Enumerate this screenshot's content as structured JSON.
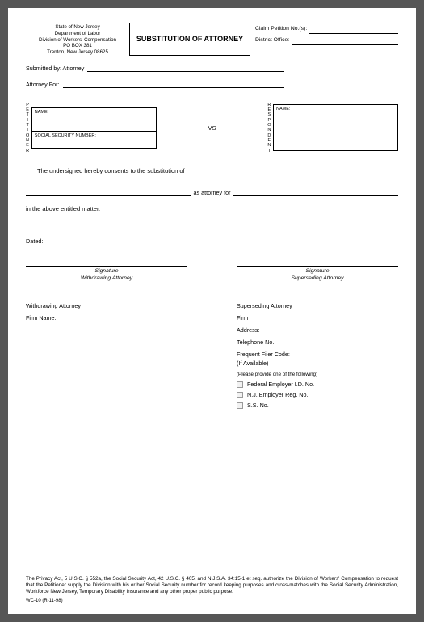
{
  "header": {
    "agency_line1": "State of New Jersey",
    "agency_line2": "Department of Labor",
    "agency_line3": "Division of Workers' Compensation",
    "agency_line4": "PO BOX 381",
    "agency_line5": "Trenton, New Jersey 08625",
    "title": "SUBSTITUTION OF ATTORNEY",
    "claim_label": "Claim Petition No.(s):",
    "claim_value": "",
    "district_label": "District Office:",
    "district_value": ""
  },
  "submitted": {
    "label": "Submitted by: Attorney",
    "value": ""
  },
  "attorney_for": {
    "label": "Attorney For:",
    "value": ""
  },
  "petitioner": {
    "vertical": "PETITIONER",
    "name_label": "NAME:",
    "name_value": "",
    "ssn_label": "SOCIAL SECURITY NUMBER:",
    "ssn_value": ""
  },
  "vs": "VS",
  "respondent": {
    "vertical": "RESPONDENT",
    "name_label": "NAME:",
    "name_value": ""
  },
  "consent_text": "The undersigned hereby consents to the substitution of",
  "as_attorney_for": "as attorney for",
  "in_above": "in the above entitled matter.",
  "dated_label": "Dated:",
  "sig_withdrawing_line1": "Signature",
  "sig_withdrawing_line2": "Withdrawing Attorney",
  "sig_superseding_line1": "Signature",
  "sig_superseding_line2": "Superseding Attorney",
  "withdrawing": {
    "header": "Withdrawing Attorney",
    "firm_label": "Firm Name:"
  },
  "superseding": {
    "header": "Superseding Attorney",
    "firm_label": "Firm",
    "address_label": "Address:",
    "tel_label": "Telephone No.:",
    "ffc_label": "Frequent Filer Code:",
    "ffc_sub": "(If Available)",
    "provide_one": "(Please provide one of the following)",
    "opt1": "Federal Employer I.D. No.",
    "opt2": "N.J. Employer Reg. No.",
    "opt3": "S.S. No."
  },
  "footer_text": "The Privacy Act, 5 U.S.C. § 552a, the Social Security Act, 42 U.S.C. § 405, and N.J.S.A. 34:15-1 et seq. authorize the Division of Workers' Compensation to request that the Petitioner supply the Division with his or her Social Security number for record keeping purposes and cross-matches with the Social Security Administration, Workforce New Jersey, Temporary Disability Insurance and any other proper public purpose.",
  "form_no": "WC-10 (R-11-98)"
}
